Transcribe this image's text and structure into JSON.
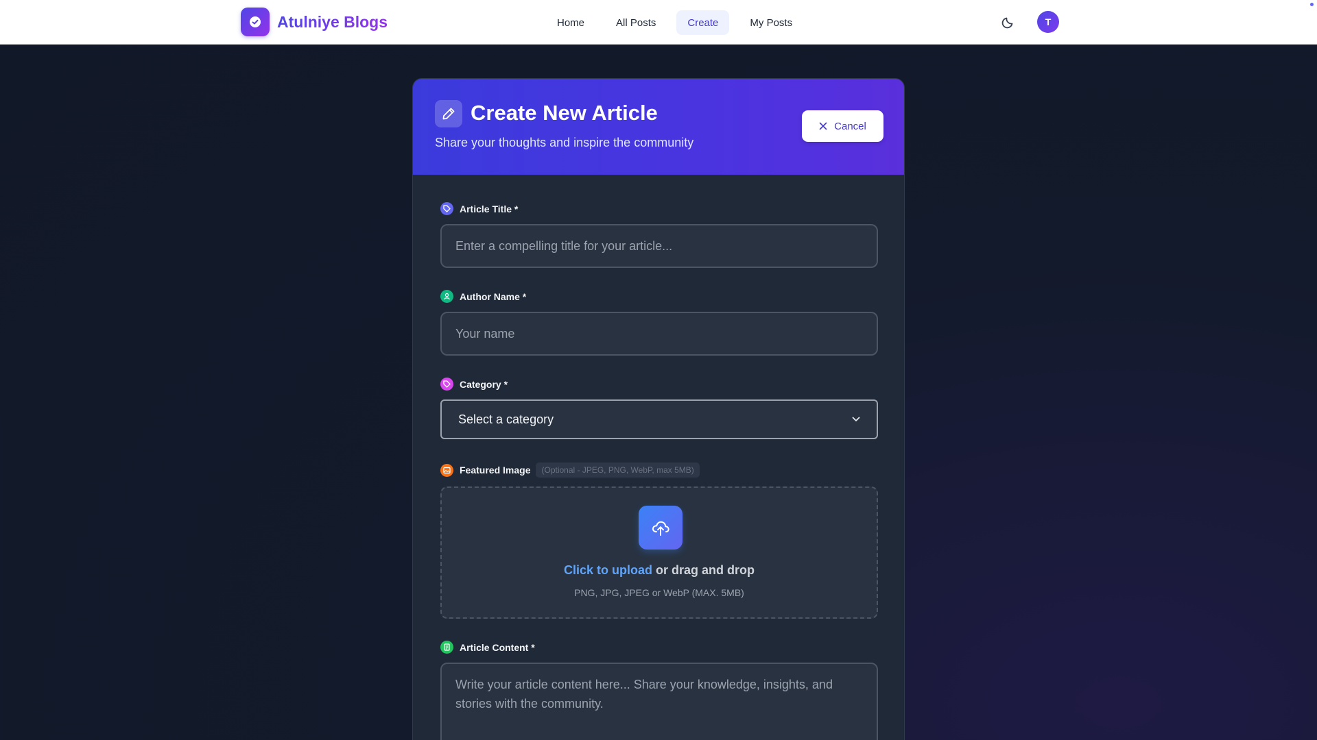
{
  "nav": {
    "brand": "Atulniye Blogs",
    "links": [
      "Home",
      "All Posts",
      "Create",
      "My Posts"
    ],
    "active": "Create",
    "avatar_initial": "T"
  },
  "form_header": {
    "title": "Create New Article",
    "subtitle": "Share your thoughts and inspire the community",
    "cancel_label": "Cancel"
  },
  "fields": {
    "title": {
      "label": "Article Title *",
      "placeholder": "Enter a compelling title for your article..."
    },
    "author": {
      "label": "Author Name *",
      "placeholder": "Your name"
    },
    "category": {
      "label": "Category *",
      "selected": "Select a category"
    },
    "image": {
      "label": "Featured Image",
      "hint": "(Optional - JPEG, PNG, WebP, max 5MB)",
      "upload_link": "Click to upload",
      "upload_rest": " or drag and drop",
      "formats": "PNG, JPG, JPEG or WebP (MAX. 5MB)"
    },
    "content": {
      "label": "Article Content *",
      "placeholder": "Write your article content here... Share your knowledge, insights, and stories with the community."
    }
  },
  "colors": {
    "accent": "#4f46e5",
    "header_gradient_start": "#3b3bdc",
    "header_gradient_end": "#5a2fdc",
    "card_bg": "#1f2937",
    "page_bg": "#111827",
    "title_icon_bg": "#6366f1",
    "author_icon_bg": "#10b981",
    "category_icon_bg": "#d946ef",
    "image_icon_bg": "#f97316",
    "content_icon_bg": "#22c55e"
  },
  "icons": {
    "brand": "book-logo-icon",
    "theme": "moon-icon",
    "header": "pencil-icon",
    "cancel": "close-icon",
    "title": "tag-icon",
    "author": "user-icon",
    "category": "tag-icon",
    "image": "image-icon",
    "upload": "cloud-upload-icon",
    "content": "document-icon"
  }
}
